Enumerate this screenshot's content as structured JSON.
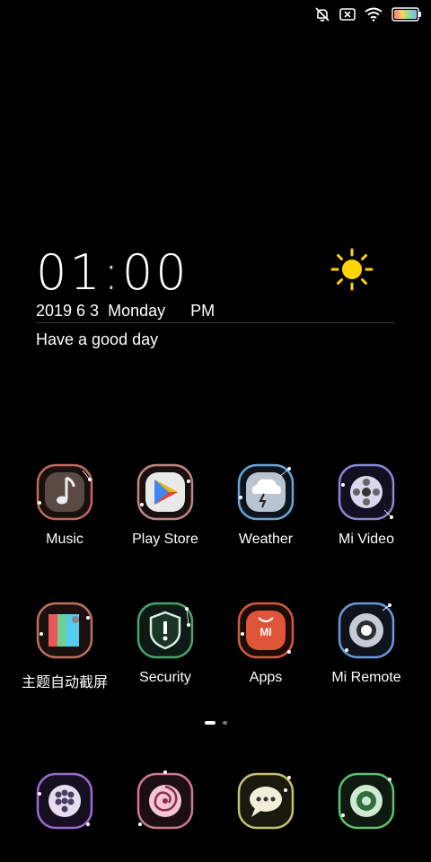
{
  "status_bar": {
    "icons": [
      "mute-icon",
      "sim-disabled-icon",
      "wifi-icon",
      "battery-icon"
    ]
  },
  "widget": {
    "hour": "01",
    "minute": "00",
    "date": "2019 6 3",
    "weekday": "Monday",
    "ampm": "PM",
    "greeting": "Have a good day",
    "weather_icon": "sun-icon",
    "sun_color": "#FFD400"
  },
  "apps_row1": [
    {
      "label": "Music",
      "icon": "music-note-icon",
      "color": "#c06a5a"
    },
    {
      "label": "Play Store",
      "icon": "play-triangle-icon",
      "color": "#c08585"
    },
    {
      "label": "Weather",
      "icon": "storm-cloud-icon",
      "color": "#6aa5d8"
    },
    {
      "label": "Mi Video",
      "icon": "film-reel-icon",
      "color": "#8b86d6"
    }
  ],
  "apps_row2": [
    {
      "label": "主题自动截屏",
      "icon": "gallery-icon",
      "color": "#c07060"
    },
    {
      "label": "Security",
      "icon": "shield-icon",
      "color": "#4aa371"
    },
    {
      "label": "Apps",
      "icon": "shopping-bag-icon",
      "color": "#d65b3f"
    },
    {
      "label": "Mi Remote",
      "icon": "remote-ring-icon",
      "color": "#6a9bd8"
    }
  ],
  "page_indicator": {
    "pages": 2,
    "current": 1
  },
  "dock": [
    {
      "icon": "dialer-icon",
      "color": "#9b6ad0"
    },
    {
      "icon": "browser-swirl-icon",
      "color": "#d07a90"
    },
    {
      "icon": "messaging-icon",
      "color": "#c8c070"
    },
    {
      "icon": "camera-aperture-icon",
      "color": "#5ec070"
    }
  ]
}
